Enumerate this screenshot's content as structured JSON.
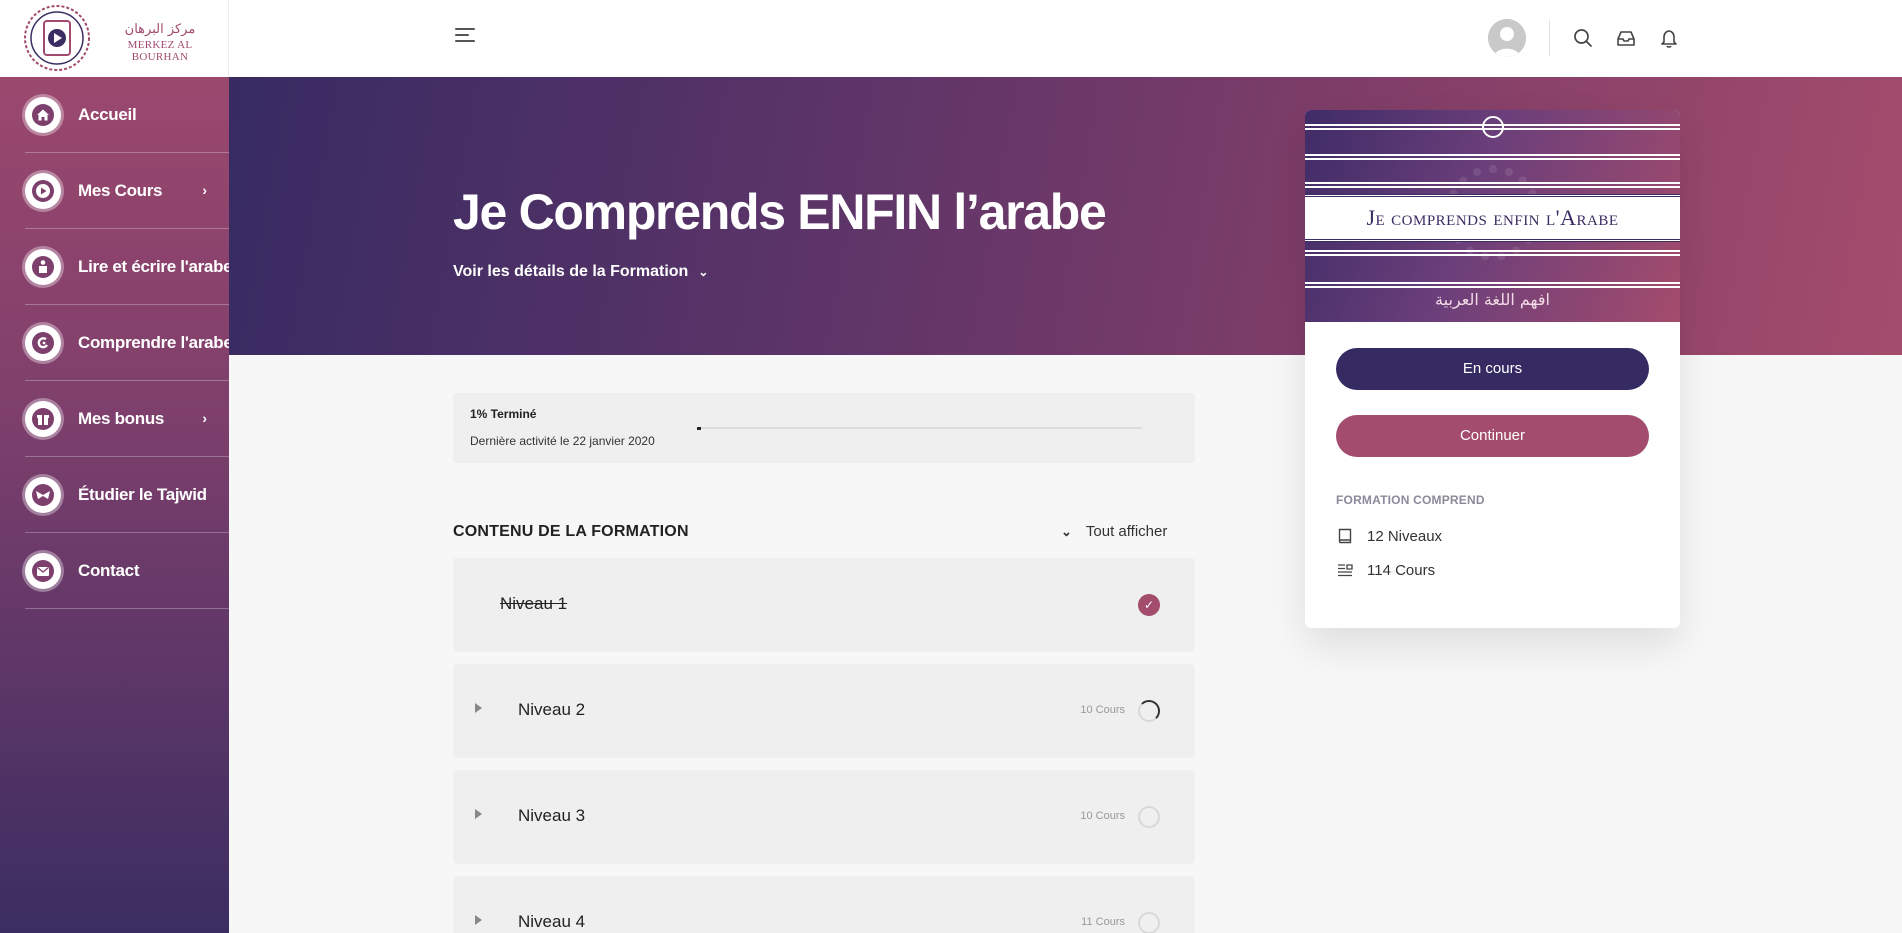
{
  "logo": {
    "arabic": "مركز البرهان",
    "latin": "MERKEZ AL BOURHAN"
  },
  "sidebar": {
    "items": [
      {
        "label": "Accueil",
        "icon": "home-icon",
        "has_submenu": false
      },
      {
        "label": "Mes Cours",
        "icon": "play-icon",
        "has_submenu": true
      },
      {
        "label": "Lire et écrire l'arabe",
        "icon": "reading-person-icon",
        "has_submenu": false
      },
      {
        "label": "Comprendre l'arabe",
        "icon": "arabic-letter-icon",
        "has_submenu": false
      },
      {
        "label": "Mes bonus",
        "icon": "gift-icon",
        "has_submenu": true
      },
      {
        "label": "Étudier le Tajwid",
        "icon": "tajwid-icon",
        "has_submenu": false
      },
      {
        "label": "Contact",
        "icon": "envelope-icon",
        "has_submenu": false
      }
    ],
    "submenu_chevron": "›"
  },
  "header": {
    "menu_icon": "hamburger-icon",
    "icons": [
      "search-icon",
      "inbox-icon",
      "bell-icon"
    ]
  },
  "hero": {
    "title": "Je Comprends ENFIN l’arabe",
    "details_link": "Voir les détails de la Formation",
    "details_chevron": "⌄"
  },
  "progress": {
    "percent_label": "1% Terminé",
    "percent_value": 1,
    "last_activity": "Dernière activité le 22 janvier 2020"
  },
  "content": {
    "section_title": "CONTENU DE LA FORMATION",
    "show_all": "Tout afficher",
    "show_all_chevron": "⌄",
    "levels": [
      {
        "name": "Niveau 1",
        "count": "",
        "status": "completed",
        "status_glyph": "✓"
      },
      {
        "name": "Niveau 2",
        "count": "10 Cours",
        "status": "in-progress"
      },
      {
        "name": "Niveau 3",
        "count": "10 Cours",
        "status": "not-started"
      },
      {
        "name": "Niveau 4",
        "count": "11 Cours",
        "status": "not-started"
      }
    ]
  },
  "course_card": {
    "cover_title_first": "J",
    "cover_title_rest": "e comprends enfin l'",
    "cover_title_a": "A",
    "cover_title_end": "rabe",
    "cover_arabic": "افهم اللغة العربية",
    "status_button": "En cours",
    "continue_button": "Continuer",
    "includes_title": "FORMATION COMPREND",
    "includes": [
      {
        "icon": "book-icon",
        "text": "12 Niveaux"
      },
      {
        "icon": "list-icon",
        "text": "114 Cours"
      }
    ]
  },
  "colors": {
    "primary": "#352b62",
    "accent": "#a44c6c",
    "sidebar_top": "#a24a6e",
    "sidebar_bottom": "#3b2d62"
  }
}
